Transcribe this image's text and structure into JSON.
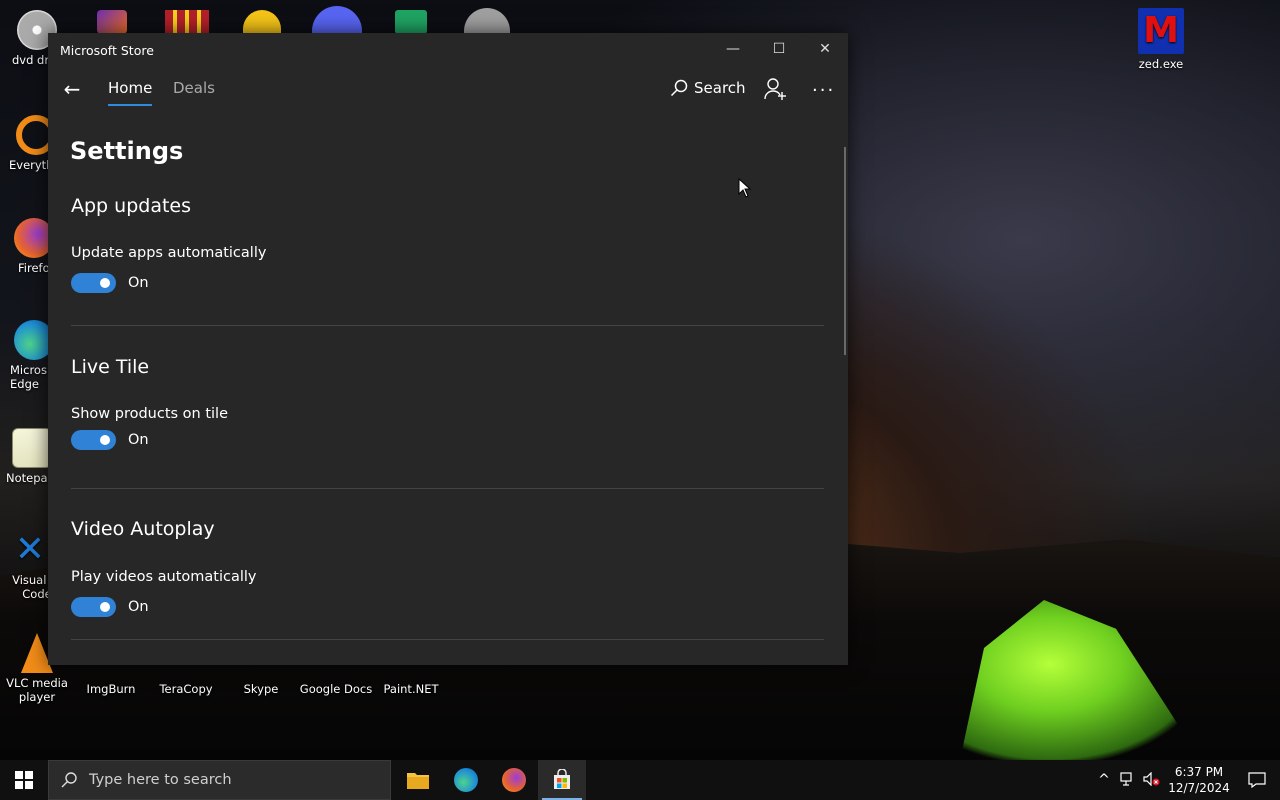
{
  "desktop": {
    "icons_left": [
      {
        "label": "dvd dri",
        "top_text": "DVD-RC",
        "color": "#cfcfcf"
      },
      {
        "label": "Everyth",
        "color": "#f28c18"
      },
      {
        "label": "Firefo",
        "color": "#e8632d"
      },
      {
        "label": "Micros\nEdge",
        "color": "#1e8fd6"
      },
      {
        "label": "Notepac",
        "color": "#6aa84f"
      },
      {
        "label": "Visual St\nCode",
        "color": "#1f7ad6"
      },
      {
        "label": "VLC media\nplayer",
        "color": "#f28c18"
      }
    ],
    "icons_bottom": [
      {
        "label": "ImgBurn"
      },
      {
        "label": "TeraCopy"
      },
      {
        "label": "Skype"
      },
      {
        "label": "Google Docs"
      },
      {
        "label": "Paint.NET"
      }
    ],
    "icon_right": {
      "label": "zed.exe",
      "glyph": "M"
    }
  },
  "window": {
    "title": "Microsoft Store",
    "controls": {
      "minimize": "—",
      "maximize": "☐",
      "close": "✕"
    },
    "nav": {
      "back_glyph": "←",
      "tabs": [
        {
          "label": "Home",
          "active": true
        },
        {
          "label": "Deals",
          "active": false
        }
      ],
      "search_label": "Search",
      "more_glyph": "..."
    },
    "settings": {
      "page_title": "Settings",
      "sections": [
        {
          "title": "App updates",
          "label": "Update apps automatically",
          "state": "On"
        },
        {
          "title": "Live Tile",
          "label": "Show products on tile",
          "state": "On"
        },
        {
          "title": "Video Autoplay",
          "label": "Play videos automatically",
          "state": "On"
        }
      ]
    }
  },
  "taskbar": {
    "search_placeholder": "Type here to search",
    "time": "6:37 PM",
    "date": "12/7/2024",
    "tray_chevron": "^"
  },
  "colors": {
    "accent": "#2f82d6",
    "window_bg": "#272727",
    "taskbar_bg": "#101010"
  }
}
